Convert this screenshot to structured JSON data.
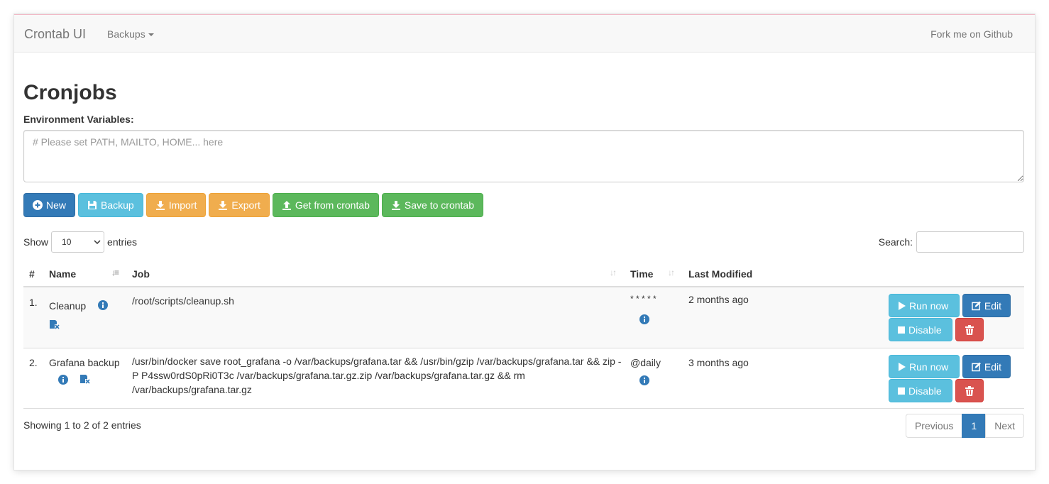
{
  "navbar": {
    "brand": "Crontab UI",
    "backups_label": "Backups",
    "github_label": "Fork me on Github"
  },
  "page": {
    "title": "Cronjobs",
    "env_label": "Environment Variables:",
    "env_placeholder": "# Please set PATH, MAILTO, HOME... here"
  },
  "toolbar": {
    "new_label": "New",
    "backup_label": "Backup",
    "import_label": "Import",
    "export_label": "Export",
    "get_label": "Get from crontab",
    "save_label": "Save to crontab"
  },
  "colors": {
    "primary": "#337ab7",
    "info": "#5bc0de",
    "warning": "#f0ad4e",
    "success": "#5cb85c",
    "danger": "#d9534f"
  },
  "table_controls": {
    "show_label": "Show",
    "entries_value": "10",
    "entries_label": "entries",
    "search_label": "Search:"
  },
  "columns": {
    "index": "#",
    "name": "Name",
    "job": "Job",
    "time": "Time",
    "modified": "Last Modified"
  },
  "rows": [
    {
      "index": "1.",
      "name": "Cleanup",
      "job": "/root/scripts/cleanup.sh",
      "time": "* * * * *",
      "modified": "2 months ago",
      "run_label": "Run now",
      "edit_label": "Edit",
      "disable_label": "Disable"
    },
    {
      "index": "2.",
      "name": "Grafana backup",
      "job": "/usr/bin/docker save root_grafana -o /var/backups/grafana.tar && /usr/bin/gzip /var/backups/grafana.tar && zip -P P4ssw0rdS0pRi0T3c /var/backups/grafana.tar.gz.zip /var/backups/grafana.tar.gz && rm /var/backups/grafana.tar.gz",
      "time": "@daily",
      "modified": "3 months ago",
      "run_label": "Run now",
      "edit_label": "Edit",
      "disable_label": "Disable"
    }
  ],
  "footer": {
    "info": "Showing 1 to 2 of 2 entries",
    "previous": "Previous",
    "current_page": "1",
    "next": "Next"
  }
}
